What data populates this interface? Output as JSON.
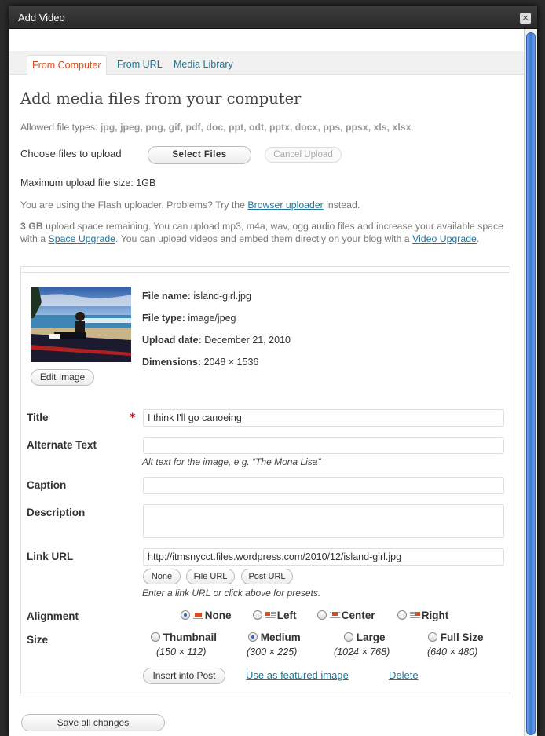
{
  "window": {
    "title": "Add Video",
    "close_glyph": "×"
  },
  "tabs": [
    {
      "label": "From Computer",
      "active": true
    },
    {
      "label": "From URL",
      "active": false
    },
    {
      "label": "Media Library",
      "active": false
    }
  ],
  "heading": "Add media files from your computer",
  "allowed": {
    "prefix": "Allowed file types: ",
    "types": "jpg, jpeg, png, gif, pdf, doc, ppt, odt, pptx, docx, pps, ppsx, xls, xlsx",
    "suffix": "."
  },
  "upload": {
    "choose_label": "Choose files to upload",
    "select_button": "Select Files",
    "cancel_button": "Cancel Upload",
    "max_size": "Maximum upload file size: 1GB"
  },
  "flash_notice": {
    "prefix": "You are using the Flash uploader. Problems? Try the ",
    "link": "Browser uploader",
    "suffix": " instead."
  },
  "space_notice": {
    "amount": "3 GB",
    "text1": " upload space remaining. You can upload mp3, m4a, wav, ogg audio files and increase your available space with a ",
    "link1": "Space Upgrade",
    "text2": ". You can upload videos and embed them directly on your blog with a ",
    "link2": "Video Upgrade",
    "text3": "."
  },
  "item": {
    "file_name_label": "File name:",
    "file_name": "island-girl.jpg",
    "file_type_label": "File type:",
    "file_type": "image/jpeg",
    "upload_date_label": "Upload date:",
    "upload_date": "December 21, 2010",
    "dimensions_label": "Dimensions:",
    "dimensions": "2048 × 1536",
    "edit_image_button": "Edit Image",
    "required_mark": "*",
    "title_label": "Title",
    "title_value": "I think I'll go canoeing",
    "alt_label": "Alternate Text",
    "alt_value": "",
    "alt_help": "Alt text for the image, e.g. “The Mona Lisa”",
    "caption_label": "Caption",
    "caption_value": "",
    "description_label": "Description",
    "description_value": "",
    "link_label": "Link URL",
    "link_value": "http://itmsnycct.files.wordpress.com/2010/12/island-girl.jpg",
    "link_buttons": [
      "None",
      "File URL",
      "Post URL"
    ],
    "link_help": "Enter a link URL or click above for presets.",
    "alignment_label": "Alignment",
    "alignment_options": [
      {
        "label": "None",
        "selected": true
      },
      {
        "label": "Left",
        "selected": false
      },
      {
        "label": "Center",
        "selected": false
      },
      {
        "label": "Right",
        "selected": false
      }
    ],
    "size_label": "Size",
    "size_options": [
      {
        "label": "Thumbnail",
        "dims": "(150 × 112)",
        "selected": false
      },
      {
        "label": "Medium",
        "dims": "(300 × 225)",
        "selected": true
      },
      {
        "label": "Large",
        "dims": "(1024 × 768)",
        "selected": false
      },
      {
        "label": "Full Size",
        "dims": "(640 × 480)",
        "selected": false
      }
    ],
    "insert_button": "Insert into Post",
    "featured_link": "Use as featured image",
    "delete_link": "Delete"
  },
  "save_button": "Save all changes"
}
